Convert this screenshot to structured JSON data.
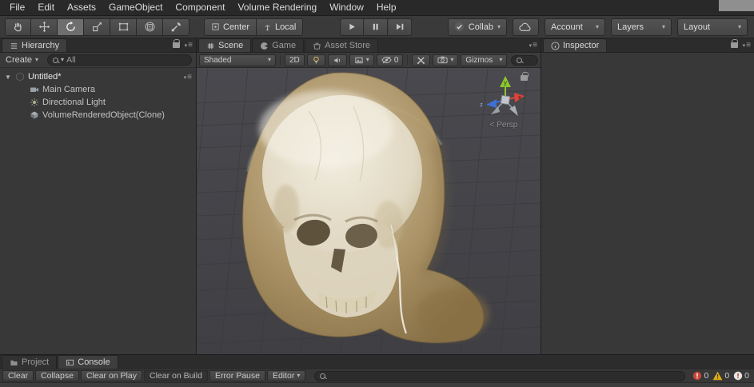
{
  "icons": {
    "dropdown_arrow": "▾",
    "pane_menu": "≡",
    "foldout_open": "▼"
  },
  "menu_bar": {
    "items": [
      "File",
      "Edit",
      "Assets",
      "GameObject",
      "Component",
      "Volume Rendering",
      "Window",
      "Help"
    ]
  },
  "toolbar": {
    "tools": [
      "hand",
      "move",
      "rotate",
      "scale",
      "rect",
      "transform",
      "custom"
    ],
    "selected_tool": "rotate",
    "pivot_center": "Center",
    "pivot_local": "Local",
    "collab": "Collab",
    "account": "Account",
    "layers": "Layers",
    "layout": "Layout"
  },
  "hierarchy": {
    "tab": "Hierarchy",
    "create": "Create",
    "search_text": "All",
    "scene_name": "Untitled*",
    "items": [
      "Main Camera",
      "Directional Light",
      "VolumeRenderedObject(Clone)"
    ]
  },
  "scene_view": {
    "tab_scene": "Scene",
    "tab_game": "Game",
    "tab_asset_store": "Asset Store",
    "shading": "Shaded",
    "mode_2d": "2D",
    "hidden_count": "0",
    "gizmos": "Gizmos",
    "persp": "< Persp",
    "axes": {
      "x": "x",
      "y": "y",
      "z": "z"
    }
  },
  "inspector": {
    "tab": "Inspector"
  },
  "bottom": {
    "tab_project": "Project",
    "tab_console": "Console",
    "btn_clear": "Clear",
    "btn_collapse": "Collapse",
    "btn_clear_on_play": "Clear on Play",
    "btn_clear_on_build": "Clear on Build",
    "btn_error_pause": "Error Pause",
    "btn_editor": "Editor",
    "error_count": "0",
    "warning_count": "0",
    "info_count": "0"
  },
  "colors": {
    "skull_bone": "#ece6d6",
    "volume_tan": "#b49a6a",
    "axis_x": "#d8453a",
    "axis_y": "#8bc72e",
    "axis_z": "#3f6fd0",
    "warning_yellow": "#dcae13",
    "error_red": "#c84639"
  }
}
